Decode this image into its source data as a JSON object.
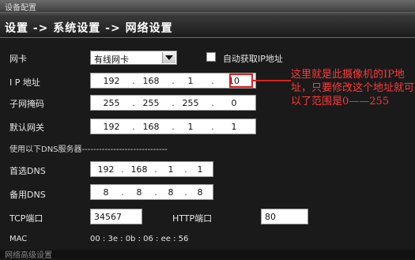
{
  "window": {
    "title": "设备配置"
  },
  "breadcrumb": "设置 -> 系统设置 -> 网络设置",
  "form": {
    "nic_label": "网卡",
    "nic_value": "有线网卡",
    "dhcp_label": "自动获取IP地址",
    "ip_label": "I P 地址",
    "ip": [
      "192",
      "168",
      "1",
      "10"
    ],
    "mask_label": "子网掩码",
    "mask": [
      "255",
      "255",
      "255",
      "0"
    ],
    "gateway_label": "默认网关",
    "gateway": [
      "192",
      "168",
      "1",
      "1"
    ],
    "dns_section": "使用以下DNS服务器------------------------------",
    "dns1_label": "首选DNS",
    "dns1": [
      "192",
      "168",
      "1",
      "1"
    ],
    "dns2_label": "备用DNS",
    "dns2": [
      "8",
      "8",
      "8",
      "8"
    ],
    "tcp_label": "TCP端口",
    "tcp_value": "34567",
    "http_label": "HTTP端口",
    "http_value": "80",
    "mac_label": "MAC",
    "mac_value": "00 : 3e : 0b : 06 : ee : 56",
    "cut_off_text": "网络高级设置"
  },
  "annotation": "这里就是此摄像机的IP地址，只要修改这个地址就可以了范围是0——255",
  "colors": {
    "annotation": "#e02020",
    "background": "#1a1a1a"
  },
  "dot": "."
}
